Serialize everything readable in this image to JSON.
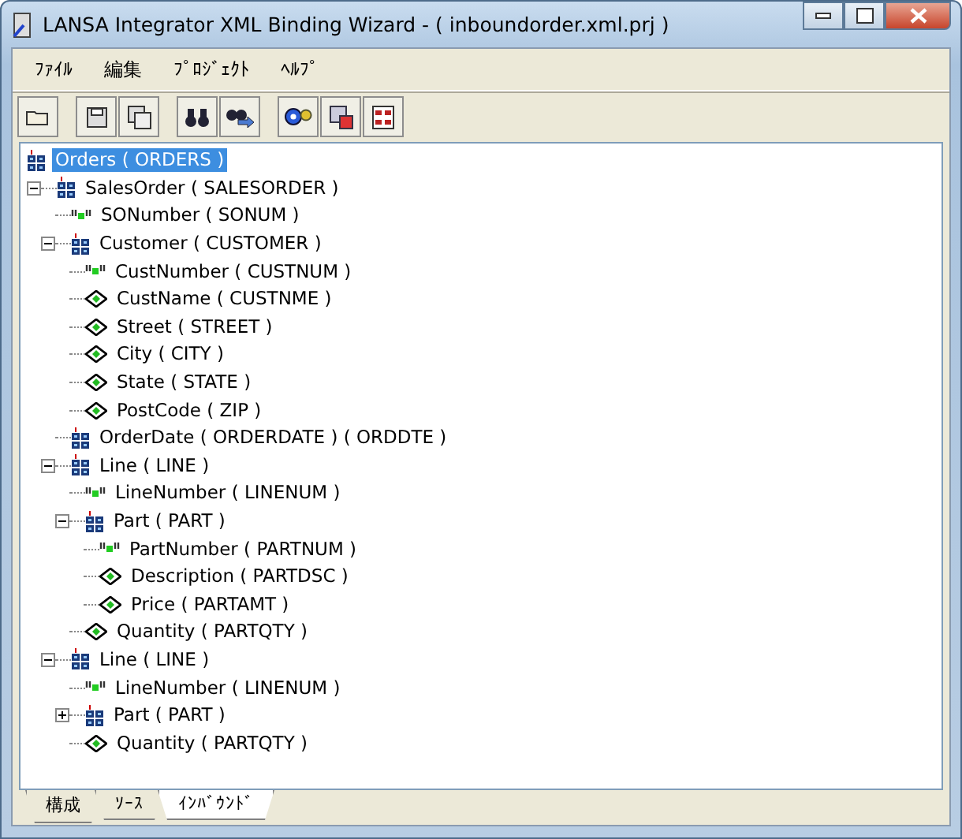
{
  "window": {
    "title": "LANSA Integrator XML Binding Wizard - ( inboundorder.xml.prj )"
  },
  "menu": [
    "ﾌｧｲﾙ",
    "編集",
    "ﾌﾟﾛｼﾞｪｸﾄ",
    "ﾍﾙﾌﾟ"
  ],
  "toolbar": [
    [
      {
        "kind": "folder"
      }
    ],
    [
      {
        "kind": "disk"
      },
      {
        "kind": "disks"
      }
    ],
    [
      {
        "kind": "binoculars"
      },
      {
        "kind": "find-next"
      }
    ],
    [
      {
        "kind": "gears"
      },
      {
        "kind": "windows"
      },
      {
        "kind": "grid"
      }
    ]
  ],
  "tree": [
    {
      "label": "Orders ( ORDERS )",
      "kind": "element",
      "selected": true,
      "children": [
        {
          "label": "SalesOrder ( SALESORDER )",
          "kind": "element",
          "selected": false,
          "expanded": true,
          "children": [
            {
              "label": "SONumber ( SONUM )",
              "kind": "attribute",
              "selected": false
            },
            {
              "label": "Customer ( CUSTOMER )",
              "kind": "element",
              "selected": false,
              "expanded": true,
              "children": [
                {
                  "label": "CustNumber ( CUSTNUM )",
                  "kind": "attribute",
                  "selected": false
                },
                {
                  "label": "CustName ( CUSTNME )",
                  "kind": "value",
                  "selected": false
                },
                {
                  "label": "Street ( STREET )",
                  "kind": "value",
                  "selected": false
                },
                {
                  "label": "City ( CITY )",
                  "kind": "value",
                  "selected": false
                },
                {
                  "label": "State ( STATE )",
                  "kind": "value",
                  "selected": false
                },
                {
                  "label": "PostCode ( ZIP )",
                  "kind": "value",
                  "selected": false
                }
              ]
            },
            {
              "label": "OrderDate ( ORDERDATE ) ( ORDDTE )",
              "kind": "element",
              "selected": false
            },
            {
              "label": "Line ( LINE )",
              "kind": "element",
              "selected": false,
              "expanded": true,
              "children": [
                {
                  "label": "LineNumber ( LINENUM )",
                  "kind": "attribute",
                  "selected": false
                },
                {
                  "label": "Part ( PART )",
                  "kind": "element",
                  "selected": false,
                  "expanded": true,
                  "children": [
                    {
                      "label": "PartNumber ( PARTNUM )",
                      "kind": "attribute",
                      "selected": false
                    },
                    {
                      "label": "Description ( PARTDSC )",
                      "kind": "value",
                      "selected": false
                    },
                    {
                      "label": "Price ( PARTAMT )",
                      "kind": "value",
                      "selected": false
                    }
                  ]
                },
                {
                  "label": "Quantity ( PARTQTY )",
                  "kind": "value",
                  "selected": false
                }
              ]
            },
            {
              "label": "Line ( LINE )",
              "kind": "element",
              "selected": false,
              "expanded": true,
              "children": [
                {
                  "label": "LineNumber ( LINENUM )",
                  "kind": "attribute",
                  "selected": false
                },
                {
                  "label": "Part ( PART )",
                  "kind": "element",
                  "selected": false,
                  "expanded": false
                },
                {
                  "label": "Quantity ( PARTQTY )",
                  "kind": "value",
                  "selected": false
                }
              ]
            }
          ]
        }
      ]
    }
  ],
  "tabs": [
    {
      "label": "構成",
      "selected": false
    },
    {
      "label": "ｿｰｽ",
      "selected": false
    },
    {
      "label": "ｲﾝﾊﾞｳﾝﾄﾞ",
      "selected": true
    }
  ]
}
